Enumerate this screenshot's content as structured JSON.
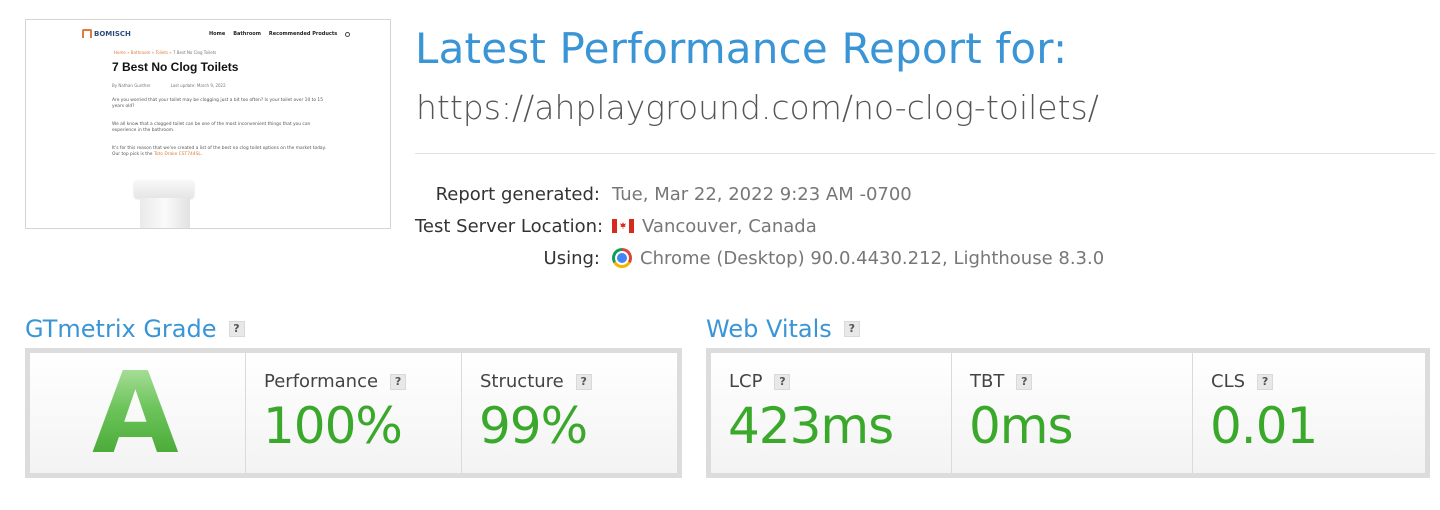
{
  "thumbnail": {
    "logo_text": "BOMISCH",
    "nav": [
      "Home",
      "Bathroom",
      "Recommended Products"
    ],
    "breadcrumb_home": "Home » Bathroom » Toilets » ",
    "breadcrumb_current": "7 Best No Clog Toilets",
    "title": "7 Best No Clog Toilets",
    "byline_author": "By Nathan Gunther",
    "byline_date": "Last update: March 9, 2022",
    "p1": "Are you worried that your toilet may be clogging just a bit too often? Is your toilet over 10 to 15 years old?",
    "p2": "We all know that a clogged toilet can be one of the most inconvenient things that you can experience in the bathroom.",
    "p3_start": "It's for this reason that we've created a list of the best no clog toilet options on the market today. Our top pick is the ",
    "p3_link": "Toto Drake CST744SL",
    "p3_end": "."
  },
  "header": {
    "title": "Latest Performance Report for:",
    "url": "https://ahplayground.com/no-clog-toilets/"
  },
  "meta": {
    "generated_label": "Report generated:",
    "generated_value": "Tue, Mar 22, 2022 9:23 AM -0700",
    "location_label": "Test Server Location:",
    "location_value": "Vancouver, Canada",
    "using_label": "Using:",
    "using_value": "Chrome (Desktop) 90.0.4430.212, Lighthouse 8.3.0"
  },
  "gtmetrix": {
    "heading": "GTmetrix Grade",
    "help": "?",
    "grade": "A",
    "performance_label": "Performance",
    "performance_value": "100%",
    "structure_label": "Structure",
    "structure_value": "99%"
  },
  "web_vitals": {
    "heading": "Web Vitals",
    "help": "?",
    "lcp_label": "LCP",
    "lcp_value": "423ms",
    "tbt_label": "TBT",
    "tbt_value": "0ms",
    "cls_label": "CLS",
    "cls_value": "0.01"
  },
  "colors": {
    "accent_blue": "#3a95d6",
    "good_green": "#3aa82a"
  }
}
